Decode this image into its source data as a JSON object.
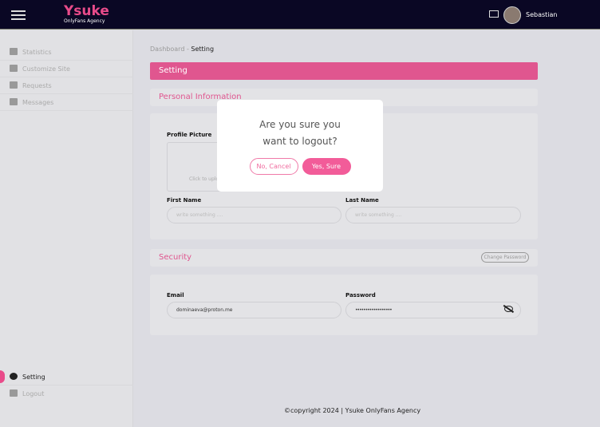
{
  "header": {
    "brand": "Ysuke",
    "brand_sub": "OnlyFans Agency",
    "user": "Sebastian"
  },
  "sidebar": {
    "items": [
      {
        "label": "Statistics"
      },
      {
        "label": "Customize Site"
      },
      {
        "label": "Requests"
      },
      {
        "label": "Messages"
      }
    ],
    "setting": "Setting",
    "logout": "Logout"
  },
  "breadcrumb": {
    "parent": "Dashboard",
    "sep": " - ",
    "current": "Setting"
  },
  "page_title": "Setting",
  "personal": {
    "title": "Personal Information",
    "profile_label": "Profile Picture",
    "upload_hint": "Click to upload",
    "first_label": "First Name",
    "first_placeholder": "write something ....",
    "last_label": "Last Name",
    "last_placeholder": "write something ...."
  },
  "security": {
    "title": "Security",
    "change_password": "Change Password",
    "email_label": "Email",
    "email_value": "dominaeva@proton.me",
    "password_label": "Password",
    "password_value": "••••••••••••••••••"
  },
  "footer": "©copyright 2024 | Ysuke OnlyFans Agency",
  "modal": {
    "question": "Are you sure you want to logout?",
    "cancel": "No, Cancel",
    "confirm": "Yes, Sure"
  }
}
